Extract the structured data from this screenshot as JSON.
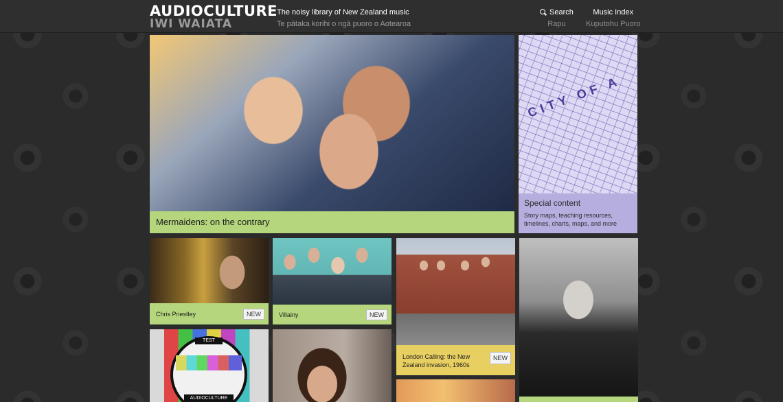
{
  "header": {
    "logo_line1": "AUDIOCULTURE",
    "logo_line2": "IWI WAIATA",
    "tagline_en": "The noisy library of New Zealand music",
    "tagline_mi": "Te pātaka korihi o ngā puoro o Aotearoa",
    "nav": [
      {
        "label": "Search",
        "sub": "Rapu",
        "icon": "search-icon"
      },
      {
        "label": "Music Index",
        "sub": "Kuputohu Puoro"
      }
    ]
  },
  "hero": {
    "caption": "Mermaidens: on the contrary"
  },
  "special": {
    "map_text": "CITY OF A",
    "title": "Special content",
    "description": "Story maps, teaching resources, timelines, charts, maps, and more"
  },
  "tiles": [
    {
      "title": "Chris Priestley",
      "badge": "NEW"
    },
    {
      "title": "Villainy",
      "badge": "NEW"
    },
    {
      "title": "London Calling: the New Zealand invasion, 1960s",
      "badge": "NEW"
    }
  ],
  "testcard": {
    "top_label": "TEST",
    "bottom_label": "AUDIOCULTURE"
  },
  "colors": {
    "green": "#b5d67c",
    "yellow": "#e8cf62",
    "purple": "#b7aee0",
    "background": "#2b2b2b"
  }
}
